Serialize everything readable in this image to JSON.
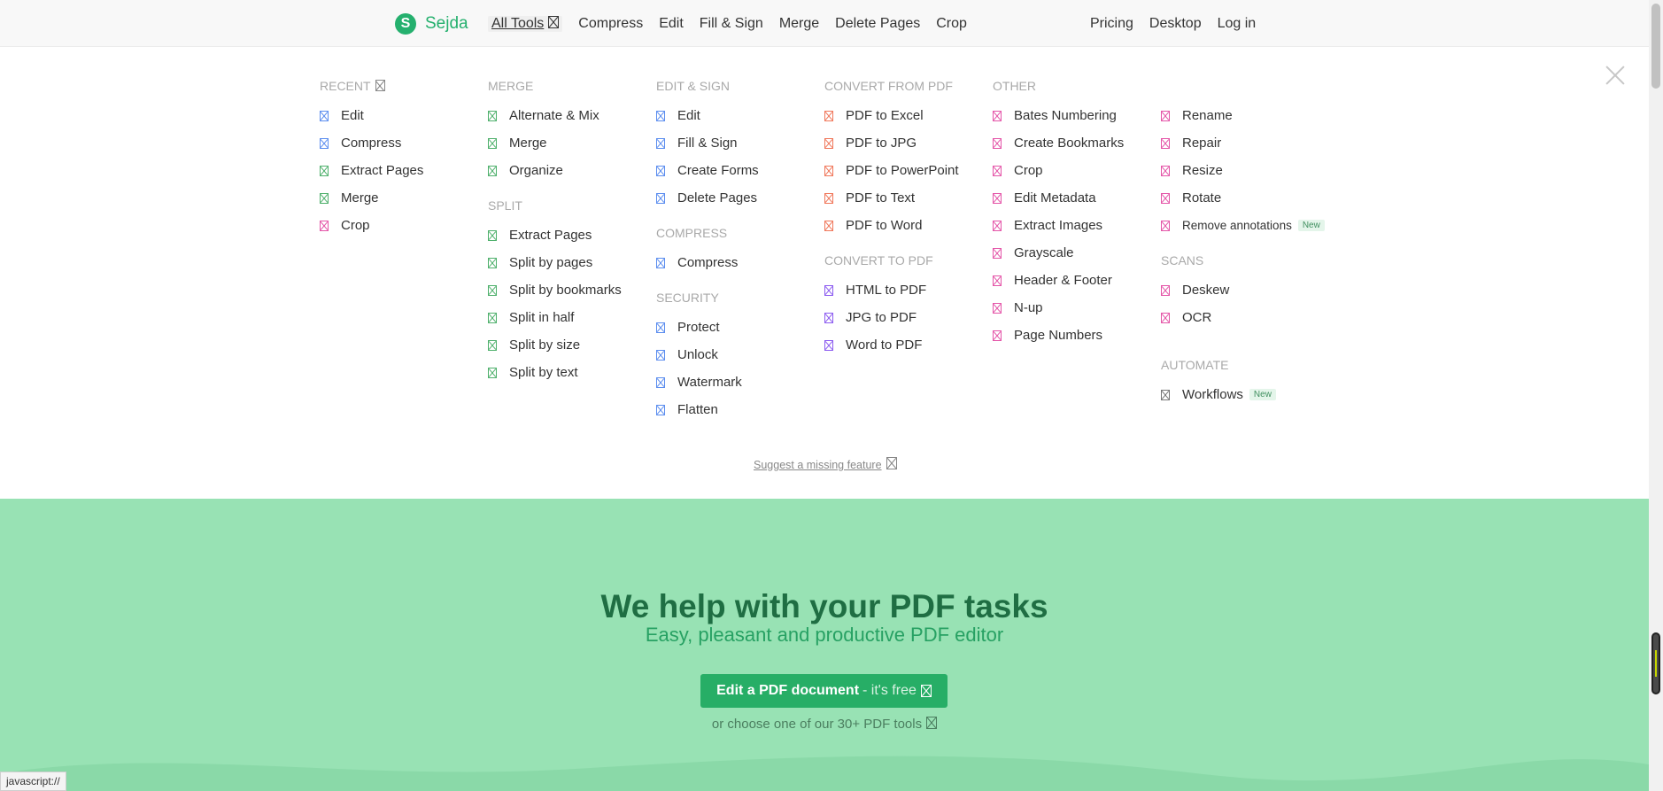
{
  "brand": {
    "name": "Sejda",
    "mark": "S",
    "color": "#25b06e"
  },
  "nav": {
    "left": [
      "All Tools",
      "Compress",
      "Edit",
      "Fill & Sign",
      "Merge",
      "Delete Pages",
      "Crop"
    ],
    "right": [
      "Pricing",
      "Desktop",
      "Log in"
    ]
  },
  "menu": {
    "recent": {
      "title": "RECENT",
      "items": [
        "Edit",
        "Compress",
        "Extract Pages",
        "Merge",
        "Crop"
      ]
    },
    "merge": {
      "title": "MERGE",
      "items": [
        "Alternate & Mix",
        "Merge",
        "Organize"
      ]
    },
    "split": {
      "title": "SPLIT",
      "items": [
        "Extract Pages",
        "Split by pages",
        "Split by bookmarks",
        "Split in half",
        "Split by size",
        "Split by text"
      ]
    },
    "edit_sign": {
      "title": "EDIT & SIGN",
      "items": [
        "Edit",
        "Fill & Sign",
        "Create Forms",
        "Delete Pages"
      ]
    },
    "compress": {
      "title": "COMPRESS",
      "items": [
        "Compress"
      ]
    },
    "security": {
      "title": "SECURITY",
      "items": [
        "Protect",
        "Unlock",
        "Watermark",
        "Flatten"
      ]
    },
    "convert_from": {
      "title": "CONVERT FROM PDF",
      "items": [
        "PDF to Excel",
        "PDF to JPG",
        "PDF to PowerPoint",
        "PDF to Text",
        "PDF to Word"
      ]
    },
    "convert_to": {
      "title": "CONVERT TO PDF",
      "items": [
        "HTML to PDF",
        "JPG to PDF",
        "Word to PDF"
      ]
    },
    "other": {
      "title": "OTHER",
      "items": [
        "Bates Numbering",
        "Create Bookmarks",
        "Crop",
        "Edit Metadata",
        "Extract Images",
        "Grayscale",
        "Header & Footer",
        "N-up",
        "Page Numbers"
      ]
    },
    "other2": {
      "items": [
        "Rename",
        "Repair",
        "Resize",
        "Rotate",
        "Remove annotations"
      ]
    },
    "scans": {
      "title": "SCANS",
      "items": [
        "Deskew",
        "OCR"
      ]
    },
    "automate": {
      "title": "AUTOMATE",
      "items": [
        "Workflows"
      ]
    },
    "new_badge": "New",
    "suggest": "Suggest a missing feature"
  },
  "hero": {
    "title": "We help with your PDF tasks",
    "subtitle": "Easy, pleasant and productive PDF editor",
    "cta_main": "Edit a PDF document",
    "cta_free": "- it's free",
    "choose": "or choose one of our 30+ PDF tools"
  },
  "status": "javascript://",
  "colors": {
    "blue": "#5b8def",
    "green": "#4fb06c",
    "orange": "#f0775a",
    "purple": "#8c5cf0",
    "pink": "#e455a8",
    "hero_bg": "#98e2b4"
  }
}
